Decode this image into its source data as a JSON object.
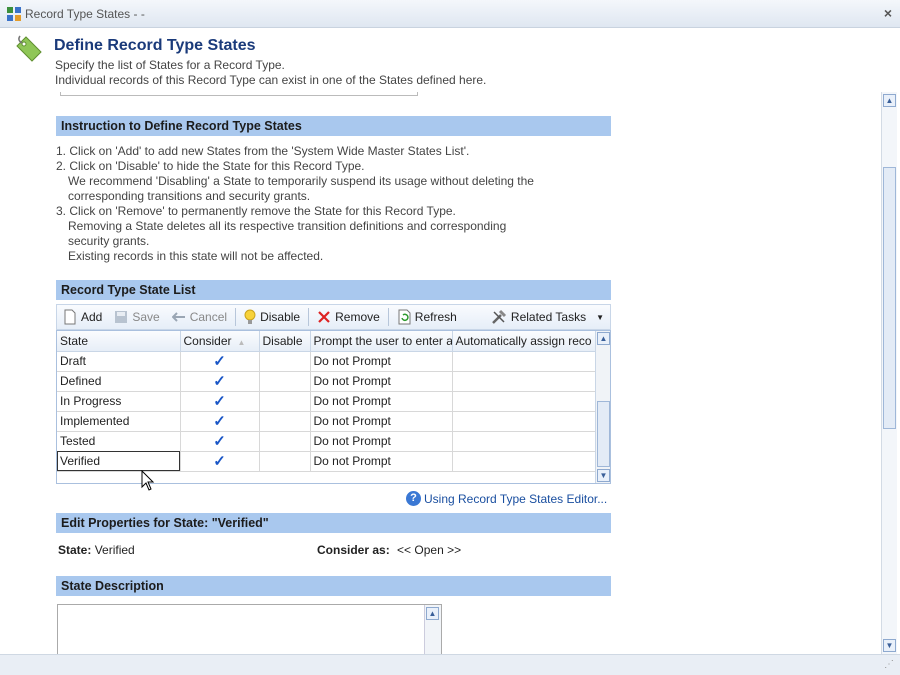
{
  "window": {
    "title": "Record Type States - -",
    "close_label": "×"
  },
  "header": {
    "title": "Define Record Type States",
    "subtitle1": "Specify the list of States for a Record Type.",
    "subtitle2": "Individual records of this Record Type can exist in one of the States defined here."
  },
  "instructions": {
    "heading": "Instruction to Define Record Type States",
    "lines": [
      "1. Click on 'Add' to add new States from the 'System Wide Master States List'.",
      "2. Click on 'Disable' to hide the State for this Record Type.",
      "We recommend 'Disabling' a State to temporarily suspend its usage without deleting the",
      "corresponding transitions and security grants.",
      "3. Click on 'Remove' to permanently remove the State for this Record Type.",
      "Removing a State deletes all its respective transition definitions and corresponding",
      "security grants.",
      "Existing records in this state will not be affected."
    ]
  },
  "state_list": {
    "heading": "Record Type State List",
    "toolbar": {
      "add": "Add",
      "save": "Save",
      "cancel": "Cancel",
      "disable": "Disable",
      "remove": "Remove",
      "refresh": "Refresh",
      "related_tasks": "Related Tasks"
    },
    "columns": [
      "State",
      "Consider",
      "Disable",
      "Prompt the user to enter a",
      "Automatically assign reco"
    ],
    "rows": [
      {
        "state": "Draft",
        "consider": "✓",
        "disable": "",
        "prompt": "Do not Prompt",
        "auto": ""
      },
      {
        "state": "Defined",
        "consider": "✓",
        "disable": "",
        "prompt": "Do not Prompt",
        "auto": ""
      },
      {
        "state": "In Progress",
        "consider": "✓",
        "disable": "",
        "prompt": "Do not Prompt",
        "auto": ""
      },
      {
        "state": "Implemented",
        "consider": "✓",
        "disable": "",
        "prompt": "Do not Prompt",
        "auto": ""
      },
      {
        "state": "Tested",
        "consider": "✓",
        "disable": "",
        "prompt": "Do not Prompt",
        "auto": ""
      },
      {
        "state": "Verified",
        "consider": "✓",
        "disable": "",
        "prompt": "Do not Prompt",
        "auto": ""
      }
    ],
    "help_link": "Using Record Type States Editor..."
  },
  "edit_props": {
    "heading": "Edit Properties for State: \"Verified\"",
    "state_label": "State:",
    "state_value": "Verified",
    "consider_label": "Consider as:",
    "consider_value": "<< Open >>"
  },
  "description": {
    "heading": "State Description"
  },
  "colors": {
    "section_header": "#a9c8ee",
    "title_blue": "#1a3a7a",
    "link_blue": "#1a4fa0"
  }
}
